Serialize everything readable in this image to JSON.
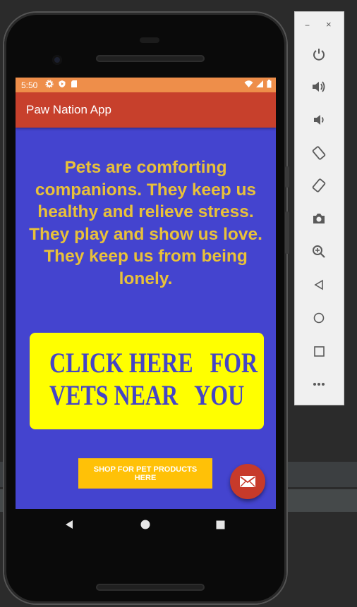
{
  "status_bar": {
    "time": "5:50",
    "color": "#ee8e4a"
  },
  "app_bar": {
    "title": "Paw Nation App",
    "color": "#c7402c"
  },
  "main": {
    "message": "Pets are comforting companions. They keep us healthy and relieve stress. They play and show us love. They keep us from being lonely.",
    "vet_banner": {
      "line1": "CLICK HERE   FOR",
      "line2": "VETS NEAR   YOU"
    },
    "shop_button": "SHOP FOR PET PRODUCTS HERE",
    "background": "#4444cf",
    "message_color": "#e8c13a"
  },
  "fab": {
    "icon": "mail-icon"
  },
  "nav": {
    "back": "back-icon",
    "home": "home-icon",
    "overview": "overview-icon"
  },
  "emulator_toolbar": {
    "minimize_label": "−",
    "close_label": "×",
    "tools": [
      "power-icon",
      "volume-up-icon",
      "volume-down-icon",
      "rotate-left-icon",
      "rotate-right-icon",
      "camera-icon",
      "zoom-icon",
      "back-icon",
      "home-icon",
      "overview-icon",
      "more-icon"
    ]
  }
}
